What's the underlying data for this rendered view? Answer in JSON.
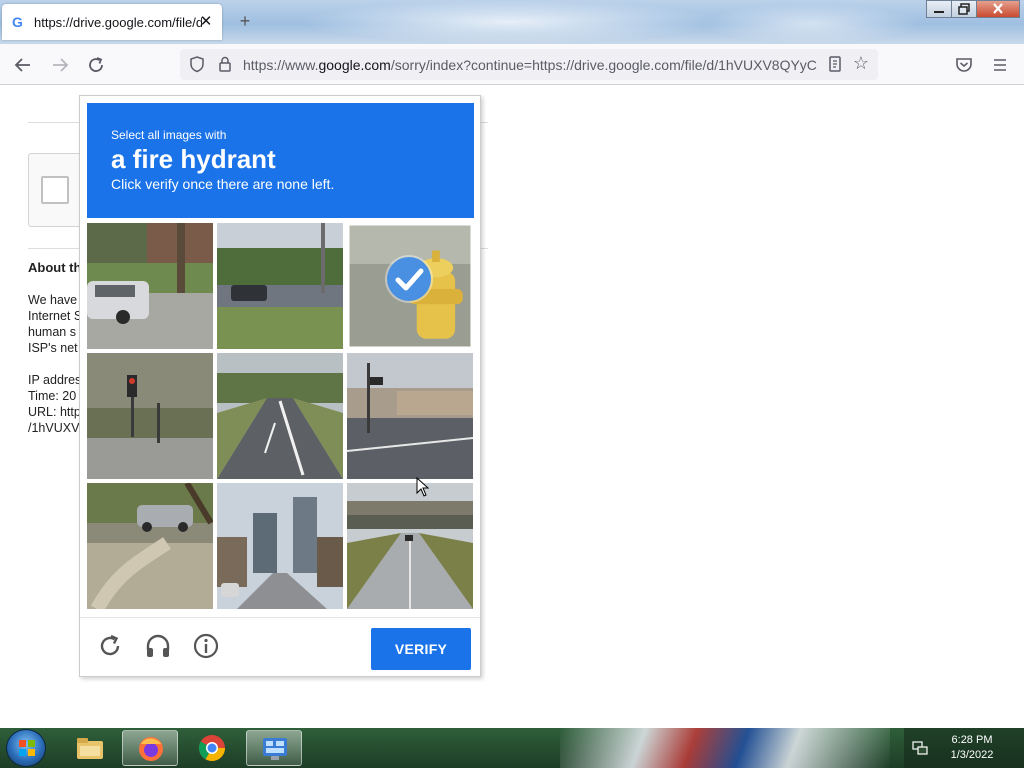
{
  "browser": {
    "tab_title": "https://drive.google.com/file/d/",
    "tab_favicon": "G",
    "tab_close": "✕",
    "new_tab": "+",
    "url_prefix": "https://www.",
    "url_domain": "google.com",
    "url_rest": "/sorry/index?continue=https://drive.google.com/file/d/1hVUXV8QYyC",
    "window_buttons": [
      "minimize",
      "restore",
      "close"
    ]
  },
  "page": {
    "about_heading": "About th",
    "paragraph_lines": [
      "We have",
      "Internet S",
      "human s",
      "ISP's net"
    ],
    "details_lines": [
      "IP addres",
      "Time: 20",
      "URL: http",
      "/1hVUXV"
    ]
  },
  "captcha": {
    "instruction_small": "Select all images with",
    "instruction_target": "a fire hydrant",
    "instruction_sub": "Click verify once there are none left.",
    "tiles": [
      {
        "scene": "residential street with white car",
        "selected": false
      },
      {
        "scene": "highway with dark car",
        "selected": false
      },
      {
        "scene": "yellow fire hydrant",
        "selected": true
      },
      {
        "scene": "intersection with traffic lights",
        "selected": false
      },
      {
        "scene": "empty highway",
        "selected": false
      },
      {
        "scene": "intersection with traffic light and buildings",
        "selected": false
      },
      {
        "scene": "tree-lined yard with parked car",
        "selected": false
      },
      {
        "scene": "city street with tall buildings",
        "selected": false
      },
      {
        "scene": "road under overpass",
        "selected": false
      }
    ],
    "footer_icons": [
      "reload-icon",
      "headphones-icon",
      "info-icon"
    ],
    "verify_label": "VERIFY",
    "accent_color": "#1a73e8"
  },
  "taskbar": {
    "apps": [
      "file-explorer",
      "firefox",
      "chrome",
      "control-panel"
    ],
    "time": "6:28 PM",
    "date": "1/3/2022"
  }
}
